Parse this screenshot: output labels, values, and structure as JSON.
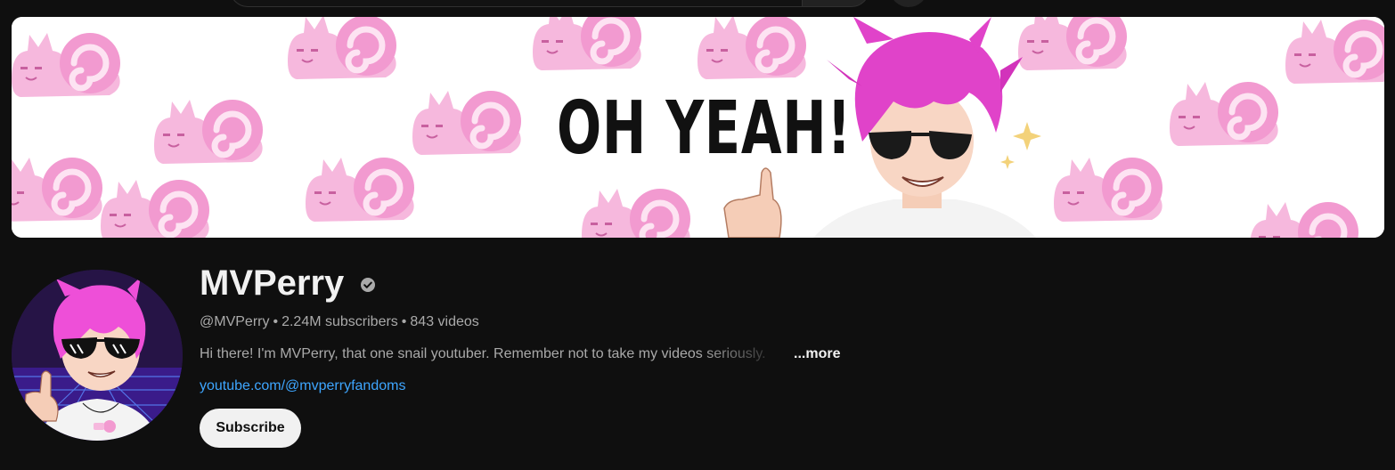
{
  "banner": {
    "text": "OH YEAH!"
  },
  "channel": {
    "name": "MVPerry",
    "handle": "@MVPerry",
    "separator": "•",
    "subscribers": "2.24M subscribers",
    "videos": "843 videos",
    "description": "Hi there! I'm MVPerry, that one snail youtuber. Remember not to take my videos seriously.",
    "more_label": "...more",
    "link": "youtube.com/@mvperryfandoms",
    "subscribe_label": "Subscribe"
  },
  "colors": {
    "background": "#0f0f0f",
    "link": "#3ea6ff",
    "snail_pink": "#f4a7d8",
    "hair_magenta": "#e040c8"
  }
}
